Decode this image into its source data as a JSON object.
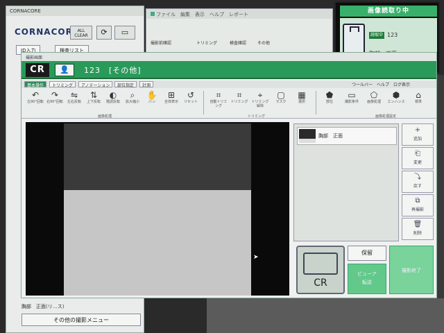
{
  "bg": {
    "title": "CORNACORE",
    "logo": "CORNACORE",
    "allclear": "ALL CLEAR",
    "tabs": [
      "ID入力",
      "検査リスト"
    ],
    "lower_text": "胸部　正面(リ…ス)",
    "menu_btn": "その他の撮影メニュー",
    "right_tabs": [
      "撮影前確認",
      "トリミング",
      "検査確認",
      "その他"
    ],
    "right_title": "ファイル　編集　表示　ヘルプ　レポート"
  },
  "reading": {
    "title": "画像読取り中",
    "badge": "読取中",
    "id": "123",
    "part": "胸部　正面",
    "progress": 0.55
  },
  "main": {
    "title": "撮影画面",
    "cr_logo": "CR",
    "patient_line": "123　[その他]",
    "tabs": [
      "基本操作",
      "トリミング",
      "アノテーション",
      "部位指定",
      "計測"
    ],
    "top_right": "つールバー　ヘルプ　ログ表示",
    "tools": [
      {
        "icon": "↶",
        "label": "左90°回転"
      },
      {
        "icon": "↷",
        "label": "右90°回転"
      },
      {
        "icon": "⇋",
        "label": "左右反転"
      },
      {
        "icon": "⇅",
        "label": "上下反転"
      },
      {
        "icon": "◐",
        "label": "階調反転"
      },
      {
        "icon": "⌕",
        "label": "拡大縮小"
      },
      {
        "icon": "✋",
        "label": "パン"
      },
      {
        "icon": "⊞",
        "label": "全体表示"
      },
      {
        "icon": "↺",
        "label": "リセット"
      },
      {
        "icon": "⌗",
        "label": "自動トリミング"
      },
      {
        "icon": "⌗",
        "label": "トリミング"
      },
      {
        "icon": "⌖",
        "label": "トリミング解除"
      },
      {
        "icon": "▢",
        "label": "マスク"
      },
      {
        "icon": "▦",
        "label": "選択"
      },
      {
        "icon": "⬟",
        "label": "部位"
      },
      {
        "icon": "▭",
        "label": "撮影条件"
      },
      {
        "icon": "⬠",
        "label": "画像処理"
      },
      {
        "icon": "⬢",
        "label": "エンハンス"
      },
      {
        "icon": "⌂",
        "label": "標準"
      }
    ],
    "group_labels": [
      "画像処理",
      "トリミング",
      "画像処理設定"
    ],
    "thumb_label": "胸部　正面",
    "side_buttons": [
      {
        "icon": "+",
        "label": "追加"
      },
      {
        "icon": "⎗",
        "label": "変更"
      },
      {
        "icon": "⤵",
        "label": "戻す"
      },
      {
        "icon": "⧉",
        "label": "再撮影"
      },
      {
        "icon": "🗑",
        "label": "削除"
      }
    ],
    "cr_button": "CR",
    "hold_button": "保留",
    "preview_button": "ビューア\n転送",
    "end_button": "撮影終了"
  }
}
